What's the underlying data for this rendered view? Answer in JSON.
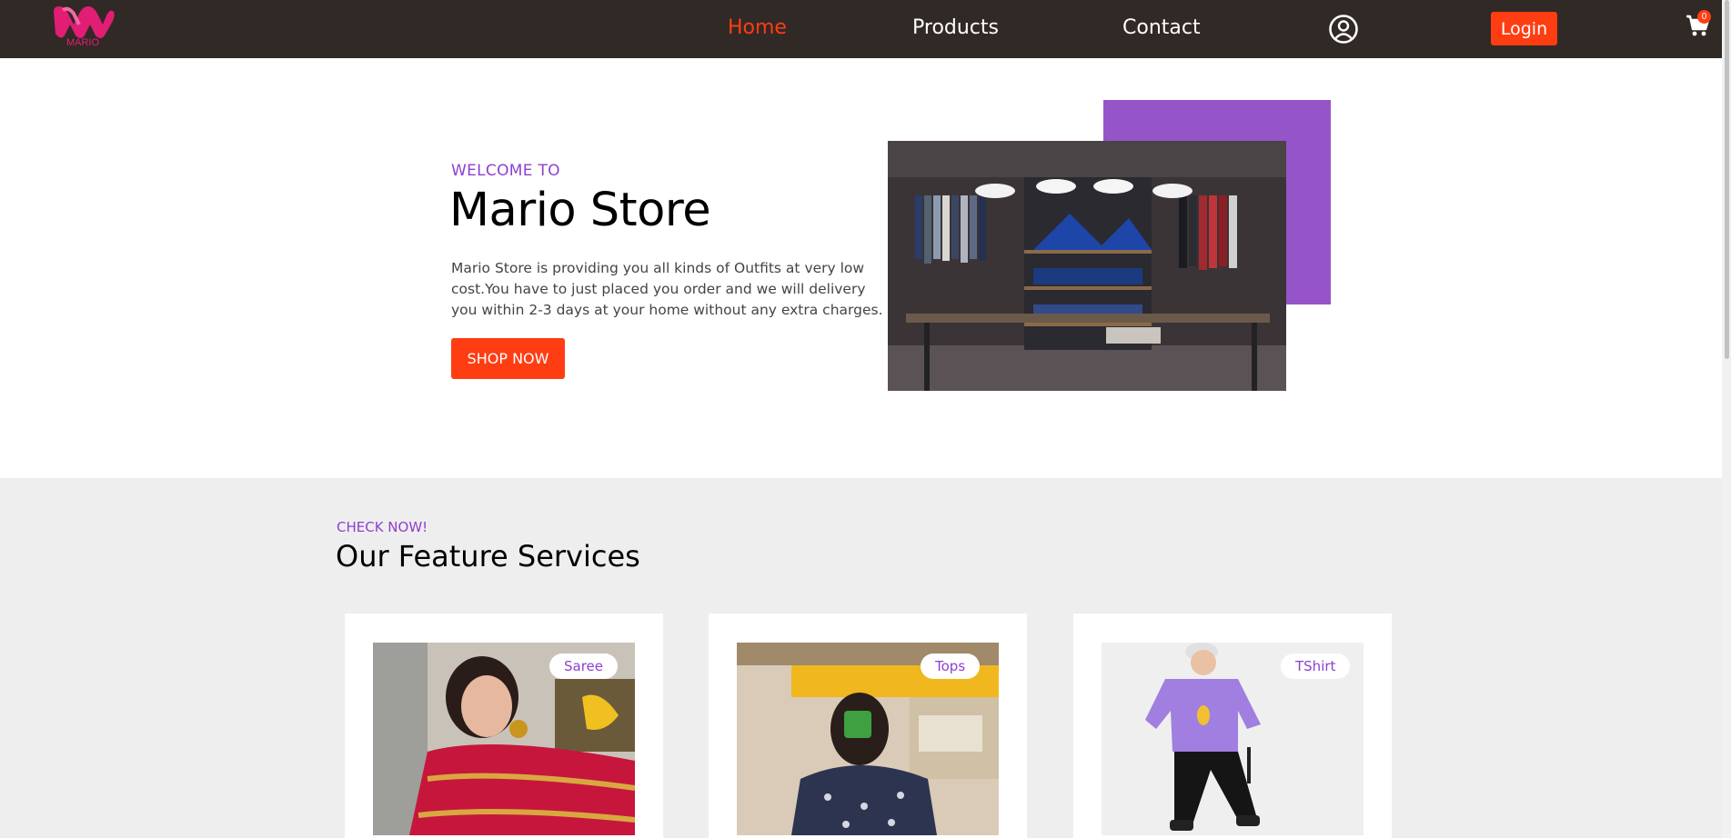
{
  "brand": {
    "logo_text": "MARIO",
    "logo_color": "#e11d74"
  },
  "nav": {
    "links": [
      {
        "label": "Home",
        "active": true
      },
      {
        "label": "Products",
        "active": false
      },
      {
        "label": "Contact",
        "active": false
      }
    ],
    "user_icon": "user-circle-icon",
    "login_label": "Login",
    "cart_icon": "shopping-cart-icon",
    "cart_count": "0"
  },
  "hero": {
    "eyebrow": "WELCOME TO",
    "title": "Mario Store",
    "description": "Mario Store is providing you all kinds of Outfits at very low cost.You have to just placed you order and we will delivery you within 2-3 days at your home without any extra charges.",
    "cta_label": "SHOP NOW",
    "image": "clothing-store-interior"
  },
  "services": {
    "eyebrow": "CHECK NOW!",
    "title": "Our Feature Services",
    "cards": [
      {
        "tag": "Saree",
        "image": "woman-in-red-saree"
      },
      {
        "tag": "Tops",
        "image": "woman-mirror-selfie-floral-top"
      },
      {
        "tag": "TShirt",
        "image": "man-in-purple-tshirt"
      }
    ]
  },
  "colors": {
    "nav_bg": "#312926",
    "accent": "#ff3d12",
    "purple": "#8f3fcf",
    "section_bg": "#efeeee"
  }
}
